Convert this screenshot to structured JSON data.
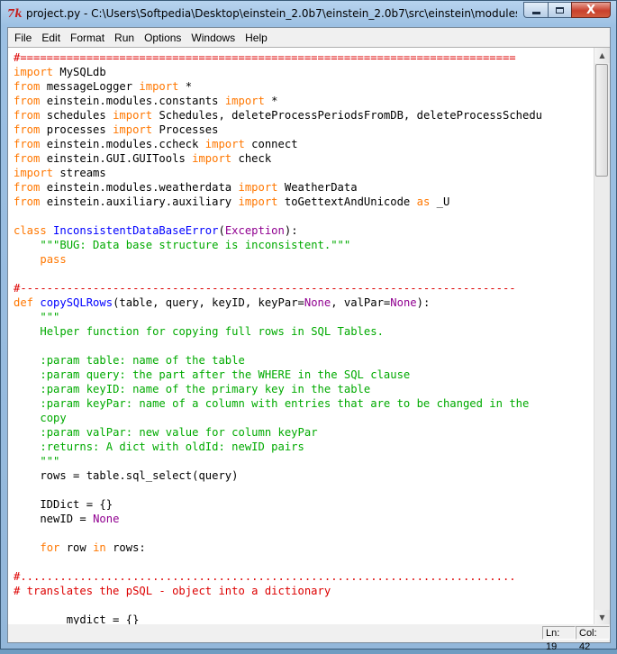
{
  "window": {
    "title": "project.py - C:\\Users\\Softpedia\\Desktop\\einstein_2.0b7\\einstein_2.0b7\\src\\einstein\\modules\\project...",
    "icon": "7k",
    "close_label": "X"
  },
  "menu": [
    "File",
    "Edit",
    "Format",
    "Run",
    "Options",
    "Windows",
    "Help"
  ],
  "code_lines": [
    [
      {
        "t": "#===========================================================================",
        "c": "t-com"
      }
    ],
    [
      {
        "t": "import",
        "c": "kw"
      },
      {
        "t": " MySQLdb",
        "c": ""
      }
    ],
    [
      {
        "t": "from",
        "c": "kw"
      },
      {
        "t": " messageLogger ",
        "c": ""
      },
      {
        "t": "import",
        "c": "kw"
      },
      {
        "t": " *",
        "c": ""
      }
    ],
    [
      {
        "t": "from",
        "c": "kw"
      },
      {
        "t": " einstein.modules.constants ",
        "c": ""
      },
      {
        "t": "import",
        "c": "kw"
      },
      {
        "t": " *",
        "c": ""
      }
    ],
    [
      {
        "t": "from",
        "c": "kw"
      },
      {
        "t": " schedules ",
        "c": ""
      },
      {
        "t": "import",
        "c": "kw"
      },
      {
        "t": " Schedules, deleteProcessPeriodsFromDB, deleteProcessSchedu",
        "c": ""
      }
    ],
    [
      {
        "t": "from",
        "c": "kw"
      },
      {
        "t": " processes ",
        "c": ""
      },
      {
        "t": "import",
        "c": "kw"
      },
      {
        "t": " Processes",
        "c": ""
      }
    ],
    [
      {
        "t": "from",
        "c": "kw"
      },
      {
        "t": " einstein.modules.ccheck ",
        "c": ""
      },
      {
        "t": "import",
        "c": "kw"
      },
      {
        "t": " connect",
        "c": ""
      }
    ],
    [
      {
        "t": "from",
        "c": "kw"
      },
      {
        "t": " einstein.GUI.GUITools ",
        "c": ""
      },
      {
        "t": "import",
        "c": "kw"
      },
      {
        "t": " check",
        "c": ""
      }
    ],
    [
      {
        "t": "import",
        "c": "kw"
      },
      {
        "t": " streams",
        "c": ""
      }
    ],
    [
      {
        "t": "from",
        "c": "kw"
      },
      {
        "t": " einstein.modules.weatherdata ",
        "c": ""
      },
      {
        "t": "import",
        "c": "kw"
      },
      {
        "t": " WeatherData",
        "c": ""
      }
    ],
    [
      {
        "t": "from",
        "c": "kw"
      },
      {
        "t": " einstein.auxiliary.auxiliary ",
        "c": ""
      },
      {
        "t": "import",
        "c": "kw"
      },
      {
        "t": " toGettextAndUnicode ",
        "c": ""
      },
      {
        "t": "as",
        "c": "kw"
      },
      {
        "t": " _U",
        "c": ""
      }
    ],
    [],
    [
      {
        "t": "class",
        "c": "kw"
      },
      {
        "t": " ",
        "c": ""
      },
      {
        "t": "InconsistentDataBaseError",
        "c": "t-def"
      },
      {
        "t": "(",
        "c": ""
      },
      {
        "t": "Exception",
        "c": "t-bi"
      },
      {
        "t": "):",
        "c": ""
      }
    ],
    [
      {
        "t": "    ",
        "c": ""
      },
      {
        "t": "\"\"\"BUG: Data base structure is inconsistent.\"\"\"",
        "c": "t-str"
      }
    ],
    [
      {
        "t": "    ",
        "c": ""
      },
      {
        "t": "pass",
        "c": "kw"
      }
    ],
    [],
    [
      {
        "t": "#---------------------------------------------------------------------------",
        "c": "t-com"
      }
    ],
    [
      {
        "t": "def",
        "c": "kw"
      },
      {
        "t": " ",
        "c": ""
      },
      {
        "t": "copySQLRows",
        "c": "t-def"
      },
      {
        "t": "(table, query, keyID, keyPar=",
        "c": ""
      },
      {
        "t": "None",
        "c": "t-bi"
      },
      {
        "t": ", valPar=",
        "c": ""
      },
      {
        "t": "None",
        "c": "t-bi"
      },
      {
        "t": "):",
        "c": ""
      }
    ],
    [
      {
        "t": "    ",
        "c": ""
      },
      {
        "t": "\"\"\"",
        "c": "t-str"
      }
    ],
    [
      {
        "t": "    ",
        "c": ""
      },
      {
        "t": "Helper function for copying full rows in SQL Tables.",
        "c": "t-str"
      }
    ],
    [],
    [
      {
        "t": "    ",
        "c": ""
      },
      {
        "t": ":param table: name of the table",
        "c": "t-str"
      }
    ],
    [
      {
        "t": "    ",
        "c": ""
      },
      {
        "t": ":param query: the part after the WHERE in the SQL clause",
        "c": "t-str"
      }
    ],
    [
      {
        "t": "    ",
        "c": ""
      },
      {
        "t": ":param keyID: name of the primary key in the table",
        "c": "t-str"
      }
    ],
    [
      {
        "t": "    ",
        "c": ""
      },
      {
        "t": ":param keyPar: name of a column with entries that are to be changed in the",
        "c": "t-str"
      }
    ],
    [
      {
        "t": "    ",
        "c": ""
      },
      {
        "t": "copy",
        "c": "t-str"
      }
    ],
    [
      {
        "t": "    ",
        "c": ""
      },
      {
        "t": ":param valPar: new value for column keyPar",
        "c": "t-str"
      }
    ],
    [
      {
        "t": "    ",
        "c": ""
      },
      {
        "t": ":returns: A dict with oldId: newID pairs",
        "c": "t-str"
      }
    ],
    [
      {
        "t": "    ",
        "c": ""
      },
      {
        "t": "\"\"\"",
        "c": "t-str"
      }
    ],
    [
      {
        "t": "    rows = table.sql_select(query)",
        "c": ""
      }
    ],
    [],
    [
      {
        "t": "    IDDict = {}",
        "c": ""
      }
    ],
    [
      {
        "t": "    newID = ",
        "c": ""
      },
      {
        "t": "None",
        "c": "t-bi"
      }
    ],
    [],
    [
      {
        "t": "    ",
        "c": ""
      },
      {
        "t": "for",
        "c": "kw"
      },
      {
        "t": " row ",
        "c": ""
      },
      {
        "t": "in",
        "c": "kw"
      },
      {
        "t": " rows:",
        "c": ""
      }
    ],
    [],
    [
      {
        "t": "#...........................................................................",
        "c": "t-com"
      }
    ],
    [
      {
        "t": "# translates the pSQL - object into a dictionary",
        "c": "t-com"
      }
    ],
    [],
    [
      {
        "t": "        mydict = {}",
        "c": ""
      }
    ]
  ],
  "status": {
    "line": "Ln: 19",
    "col": "Col: 42"
  }
}
